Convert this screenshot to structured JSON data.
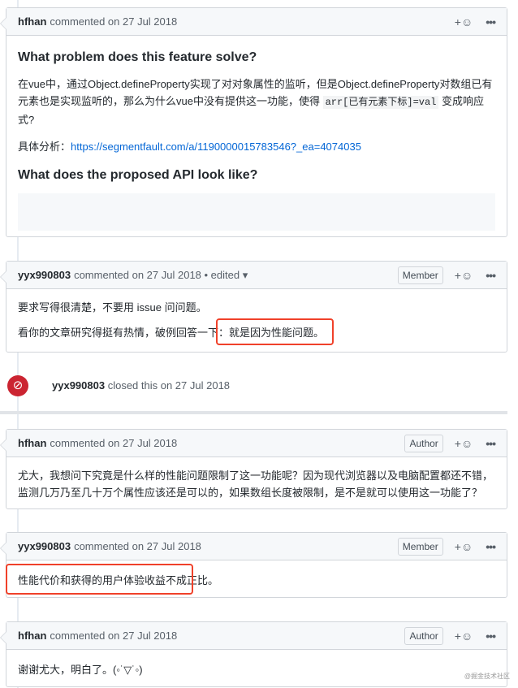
{
  "comments": [
    {
      "author": "hfhan",
      "meta": "commented on 27 Jul 2018",
      "h1": "What problem does this feature solve?",
      "p1a": "在vue中，通过Object.defineProperty实现了对对象属性的监听，但是Object.defineProperty对数组已有元素也是实现监听的，那么为什么vue中没有提供这一功能，使得 ",
      "code": "arr[已有元素下标]=val",
      "p1b": " 变成响应式?",
      "p2_label": "具体分析：",
      "link": "https://segmentfault.com/a/1190000015783546?_ea=4074035",
      "h2": "What does the proposed API look like?"
    },
    {
      "author": "yyx990803",
      "meta": "commented on 27 Jul 2018 • edited ▾",
      "badge": "Member",
      "p1": "要求写得很清楚，不要用 issue 问问题。",
      "p2a": "看你的文章研究得挺有热情，破例回答一下：",
      "p2b": "就是因为性能问题。"
    },
    {
      "author": "hfhan",
      "meta": "commented on 27 Jul 2018",
      "badge": "Author",
      "p1": "尤大，我想问下究竟是什么样的性能问题限制了这一功能呢？因为现代浏览器以及电脑配置都还不错，监测几万乃至几十万个属性应该还是可以的，如果数组长度被限制，是不是就可以使用这一功能了？"
    },
    {
      "author": "yyx990803",
      "meta": "commented on 27 Jul 2018",
      "badge": "Member",
      "p1": "性能代价和获得的用户体验收益不成正比。"
    },
    {
      "author": "hfhan",
      "meta": "commented on 27 Jul 2018",
      "badge": "Author",
      "p1": "谢谢尤大，明白了。(◦˙▽˙◦)"
    }
  ],
  "event": {
    "actor": "yyx990803",
    "text": "closed this on 27 Jul 2018",
    "icon": "closed-icon",
    "color": "#cb2431"
  },
  "reaction": "+☺",
  "more": "•••",
  "watermark": "@掘金技术社区"
}
